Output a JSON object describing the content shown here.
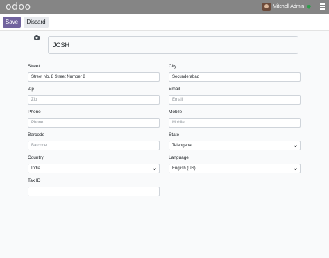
{
  "topbar": {
    "logo": "odoo",
    "user_name": "Mitchell Admin"
  },
  "controls": {
    "save_label": "Save",
    "discard_label": "Discard"
  },
  "form": {
    "name": "JOSH",
    "street_label": "Street",
    "street_value": "Street No. 8 Street Number 8",
    "city_label": "City",
    "city_value": "Secunderabad",
    "zip_label": "Zip",
    "zip_placeholder": "Zip",
    "email_label": "Email",
    "email_placeholder": "Email",
    "phone_label": "Phone",
    "phone_placeholder": "Phone",
    "mobile_label": "Mobile",
    "mobile_placeholder": "Mobile",
    "barcode_label": "Barcode",
    "barcode_placeholder": "Barcode",
    "state_label": "State",
    "state_value": "Telangana",
    "country_label": "Country",
    "country_value": "India",
    "language_label": "Language",
    "language_value": "English (US)",
    "taxid_label": "Tax ID",
    "taxid_value": ""
  },
  "colors": {
    "topbar": "#858585",
    "primary": "#71639e",
    "secondary": "#e7e9ed",
    "status_online": "#2e9e4a"
  },
  "icons": [
    "camera-icon",
    "wifi-icon",
    "menu-icon",
    "chevron-down-icon"
  ]
}
